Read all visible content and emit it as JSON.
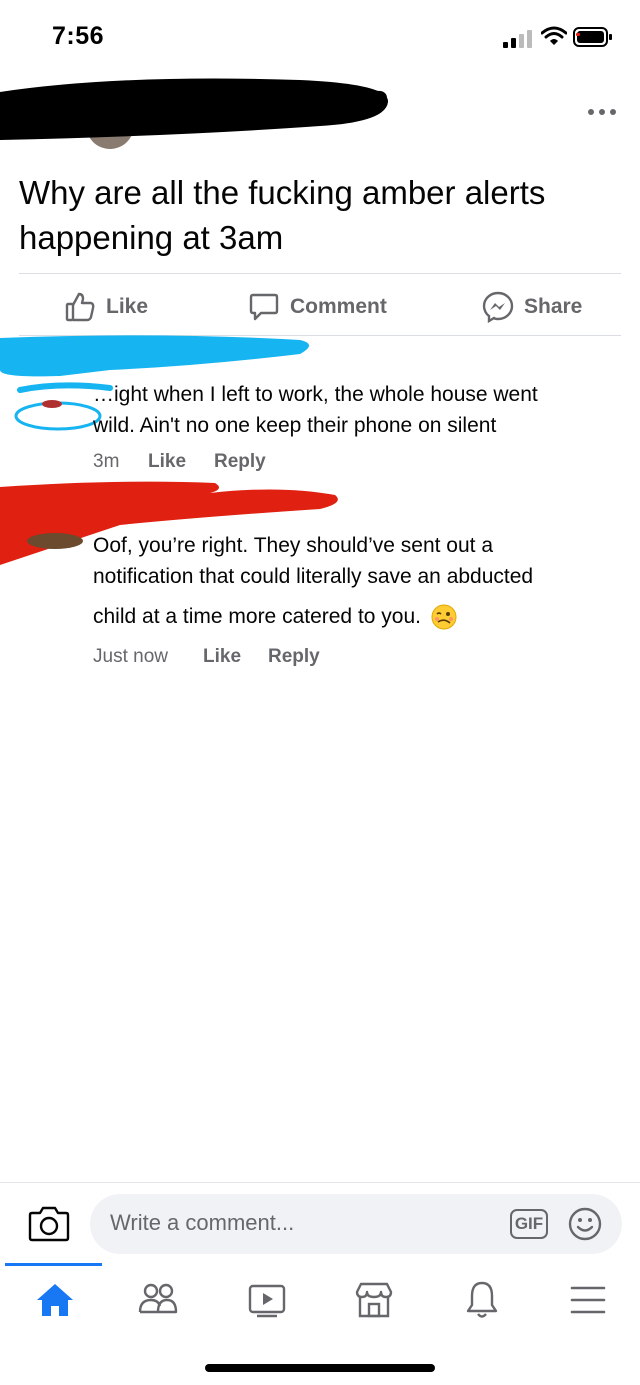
{
  "status_bar": {
    "time": "7:56"
  },
  "post": {
    "text": "Why are all the fucking amber alerts happening at 3am",
    "actions": {
      "like": "Like",
      "comment": "Comment",
      "share": "Share"
    }
  },
  "comments": [
    {
      "text_line1": "…ight when I left to work, the whole house went",
      "text_line2": "wild. Ain't no one keep their phone on silent",
      "time": "3m",
      "like": "Like",
      "reply": "Reply"
    },
    {
      "text_line1": "Oof, you’re right. They should’ve sent out a",
      "text_line2": "notification that could literally save an abducted",
      "text_line3": "child at a time more catered to you.",
      "time": "Just now",
      "like": "Like",
      "reply": "Reply"
    }
  ],
  "composer": {
    "placeholder": "Write a comment...",
    "gif_label": "GIF"
  },
  "colors": {
    "accent": "#1877f2",
    "secondary_text": "#65676b",
    "redaction_blue": "#16b4f0",
    "redaction_red": "#e02010"
  }
}
